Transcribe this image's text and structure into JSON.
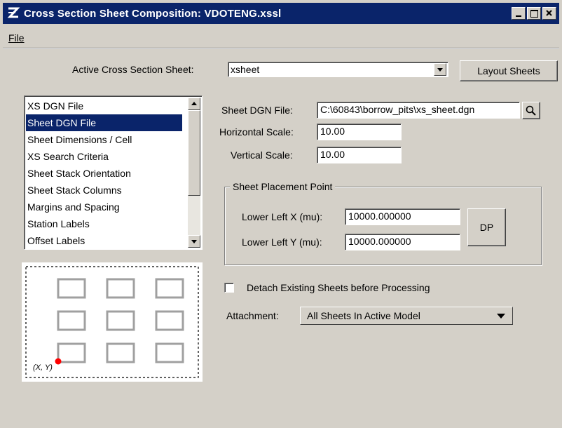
{
  "window": {
    "title": "Cross Section Sheet Composition: VDOTENG.xssl",
    "controls": [
      "minimize-icon",
      "maximize-icon",
      "close-icon"
    ]
  },
  "menu": {
    "file_label": "File"
  },
  "active_sheet": {
    "label": "Active Cross Section Sheet:",
    "value": "xsheet",
    "layout_button": "Layout Sheets"
  },
  "category_list": {
    "items": [
      "XS DGN File",
      "Sheet DGN File",
      "Sheet Dimensions / Cell",
      "XS Search Criteria",
      "Sheet Stack Orientation",
      "Sheet Stack Columns",
      "Margins and Spacing",
      "Station Labels",
      "Offset Labels"
    ],
    "selected": "Sheet DGN File"
  },
  "sheet_dgn": {
    "label": "Sheet DGN File:",
    "value": "C:\\60843\\borrow_pits\\xs_sheet.dgn"
  },
  "horizontal_scale": {
    "label": "Horizontal Scale:",
    "value": "10.00"
  },
  "vertical_scale": {
    "label": "Vertical Scale:",
    "value": "10.00"
  },
  "placement": {
    "group_label": "Sheet Placement Point",
    "x_label": "Lower Left X (mu):",
    "x_value": "10000.000000",
    "y_label": "Lower Left Y (mu):",
    "y_value": "10000.000000",
    "dp_button": "DP"
  },
  "detach": {
    "label": "Detach Existing Sheets before Processing",
    "checked": false
  },
  "attachment": {
    "label": "Attachment:",
    "value": "All Sheets In Active Model"
  },
  "preview": {
    "origin_label": "(X, Y)"
  },
  "colors": {
    "titlebar": "#0a246a",
    "face": "#d4d0c8",
    "selection": "#0a246a",
    "origin_marker": "#ff0000"
  }
}
